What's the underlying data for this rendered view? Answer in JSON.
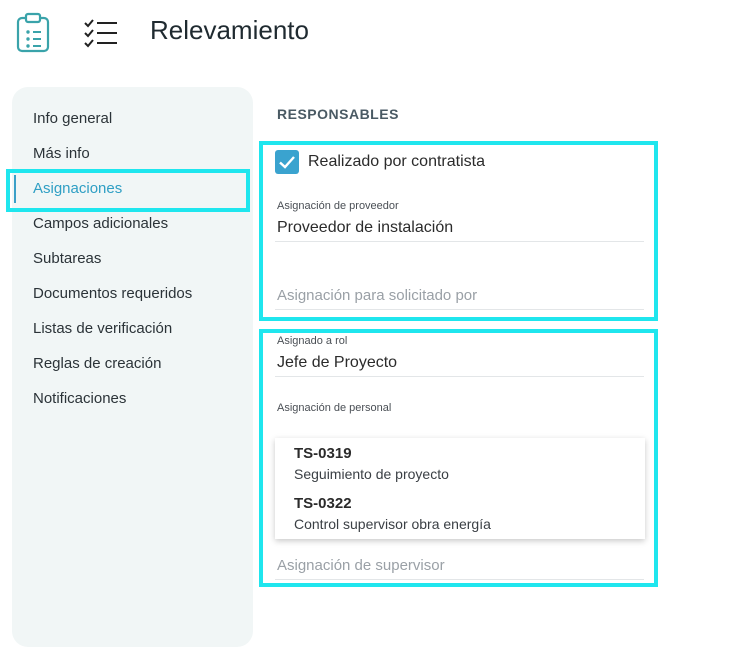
{
  "header": {
    "title": "Relevamiento",
    "app_icon": "clipboard-icon",
    "list_icon": "checklist-icon"
  },
  "sidebar": {
    "items": [
      {
        "label": "Info general",
        "active": false
      },
      {
        "label": "Más info",
        "active": false
      },
      {
        "label": "Asignaciones",
        "active": true
      },
      {
        "label": "Campos adicionales",
        "active": false
      },
      {
        "label": "Subtareas",
        "active": false
      },
      {
        "label": "Documentos requeridos",
        "active": false
      },
      {
        "label": "Listas de verificación",
        "active": false
      },
      {
        "label": "Reglas de creación",
        "active": false
      },
      {
        "label": "Notificaciones",
        "active": false
      }
    ]
  },
  "main": {
    "section_title": "RESPONSABLES",
    "contractor_checkbox": {
      "label": "Realizado por contratista",
      "checked": true
    },
    "provider_assignment": {
      "label": "Asignación de proveedor",
      "value": "Proveedor de instalación"
    },
    "requested_by": {
      "placeholder": "Asignación para solicitado por"
    },
    "role_assignment": {
      "label": "Asignado a rol",
      "value": "Jefe de Proyecto"
    },
    "personnel_assignment": {
      "label": "Asignación de personal",
      "options": [
        {
          "code": "TS-0319",
          "description": "Seguimiento de proyecto"
        },
        {
          "code": "TS-0322",
          "description": "Control supervisor obra energía"
        }
      ]
    },
    "supervisor": {
      "placeholder": "Asignación de supervisor"
    }
  },
  "colors": {
    "accent": "#3aa3cf",
    "highlight": "#1fe6ee",
    "sidebar_bg": "#f1f6f6",
    "icon_teal": "#3aa3aa"
  }
}
